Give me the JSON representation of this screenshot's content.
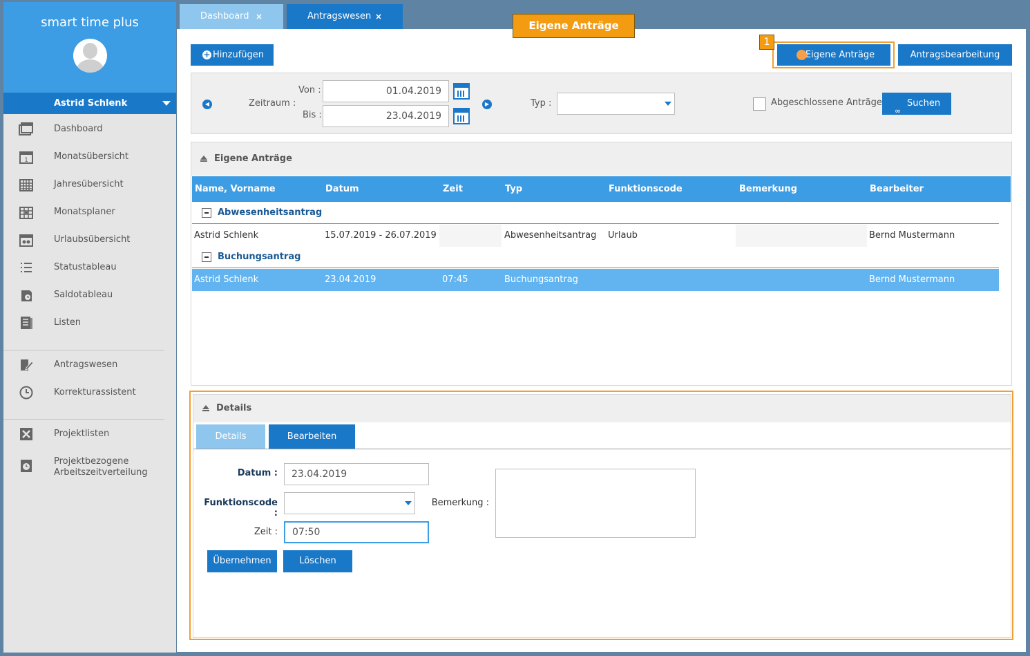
{
  "app": {
    "title": "smart time plus"
  },
  "user": {
    "name": "Astrid Schlenk"
  },
  "sidebar": {
    "items": [
      {
        "label": "Dashboard",
        "icon": "dashboard-icon"
      },
      {
        "label": "Monatsübersicht",
        "icon": "calendar-month-icon"
      },
      {
        "label": "Jahresübersicht",
        "icon": "calendar-year-icon"
      },
      {
        "label": "Monatsplaner",
        "icon": "planner-icon"
      },
      {
        "label": "Urlaubsübersicht",
        "icon": "vacation-icon"
      },
      {
        "label": "Statustableau",
        "icon": "list-icon"
      },
      {
        "label": "Saldotableau",
        "icon": "balance-icon"
      },
      {
        "label": "Listen",
        "icon": "lists-icon"
      }
    ],
    "items2": [
      {
        "label": "Antragswesen",
        "icon": "edit-request-icon"
      },
      {
        "label": "Korrekturassistent",
        "icon": "clock-icon"
      }
    ],
    "items3": [
      {
        "label": "Projektlisten",
        "icon": "tools-icon"
      },
      {
        "label": "Projektbezogene Arbeitszeitverteilung",
        "icon": "project-time-icon"
      }
    ]
  },
  "tabs": [
    {
      "label": "Dashboard",
      "close": "×"
    },
    {
      "label": "Antragswesen",
      "close": "×"
    }
  ],
  "callout": {
    "label": "Eigene Anträge",
    "badge": "1"
  },
  "toolbar": {
    "add_label": "Hinzufügen",
    "add_icon": "+",
    "own_label": "Eigene Anträge",
    "processing_label": "Antragsbearbeitung"
  },
  "filter": {
    "period_label": "Zeitraum :",
    "from_label": "Von :",
    "from_value": "01.04.2019",
    "to_label": "Bis :",
    "to_value": "23.04.2019",
    "type_label": "Typ :",
    "type_value": "",
    "completed_label": "Abgeschlossene Anträge",
    "search_label": "Suchen",
    "prev_arrow": "◀",
    "next_arrow": "▶",
    "search_icon": "∞"
  },
  "grid": {
    "title": "Eigene Anträge",
    "columns": [
      "Name, Vorname",
      "Datum",
      "Zeit",
      "Typ",
      "Funktionscode",
      "Bemerkung",
      "Bearbeiter"
    ],
    "groups": [
      {
        "name": "Abwesenheitsantrag",
        "rows": [
          {
            "name": "Astrid Schlenk",
            "date": "15.07.2019 - 26.07.2019",
            "time": "",
            "type": "Abwesenheitsantrag",
            "code": "Urlaub",
            "remark": "",
            "editor": "Bernd Mustermann"
          }
        ]
      },
      {
        "name": "Buchungsantrag",
        "rows": [
          {
            "name": "Astrid Schlenk",
            "date": "23.04.2019",
            "time": "07:45",
            "type": "Buchungsantrag",
            "code": "",
            "remark": "",
            "editor": "Bernd Mustermann"
          }
        ]
      }
    ]
  },
  "details": {
    "title": "Details",
    "tabs": [
      "Details",
      "Bearbeiten"
    ],
    "date_label": "Datum :",
    "date_value": "23.04.2019",
    "code_label": "Funktionscode :",
    "code_value": "",
    "time_label": "Zeit :",
    "time_value": "07:50",
    "remark_label": "Bemerkung :",
    "remark_value": "",
    "apply_label": "Übernehmen",
    "delete_label": "Löschen"
  },
  "colors": {
    "accent": "#1a78c8",
    "header": "#3c9ce4",
    "highlight": "#f39c12"
  }
}
